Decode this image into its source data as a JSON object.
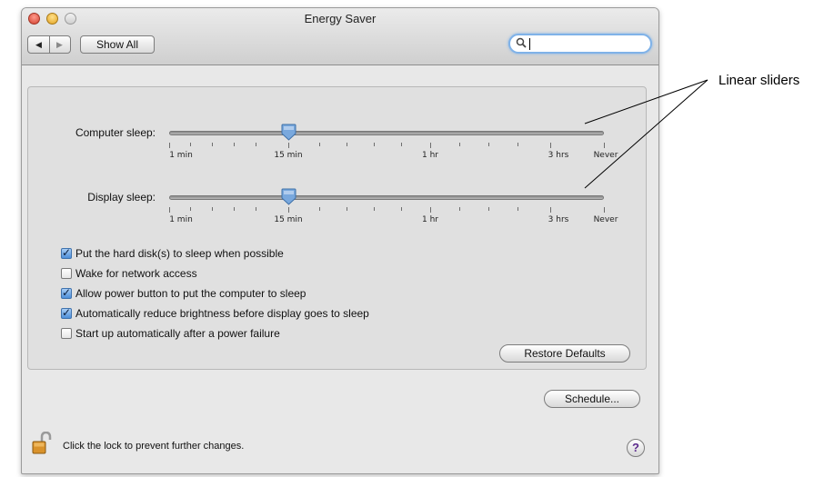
{
  "window": {
    "title": "Energy Saver",
    "show_all_label": "Show All",
    "nav_back_icon": "◀",
    "nav_forward_icon": "▶",
    "search": {
      "value": "",
      "placeholder": "",
      "icon": "magnifier"
    }
  },
  "sliders": {
    "tick_labels": [
      "1 min",
      "15 min",
      "1 hr",
      "3 hrs",
      "Never"
    ],
    "computer_sleep": {
      "label": "Computer sleep:",
      "value": "15 min"
    },
    "display_sleep": {
      "label": "Display sleep:",
      "value": "15 min"
    }
  },
  "options": [
    {
      "label": "Put the hard disk(s) to sleep when possible",
      "checked": true
    },
    {
      "label": "Wake for network access",
      "checked": false
    },
    {
      "label": "Allow power button to put the computer to sleep",
      "checked": true
    },
    {
      "label": "Automatically reduce brightness before display goes to sleep",
      "checked": true
    },
    {
      "label": "Start up automatically after a power failure",
      "checked": false
    }
  ],
  "buttons": {
    "restore_defaults": "Restore Defaults",
    "schedule": "Schedule..."
  },
  "footer": {
    "lock_text": "Click the lock to prevent further changes.",
    "help_label": "?"
  },
  "annotation": {
    "label": "Linear sliders"
  },
  "colors": {
    "accent": "#4d8fd9",
    "search_focus": "#7fb2e8",
    "close": "#d2412f",
    "minimize": "#e2a322"
  }
}
